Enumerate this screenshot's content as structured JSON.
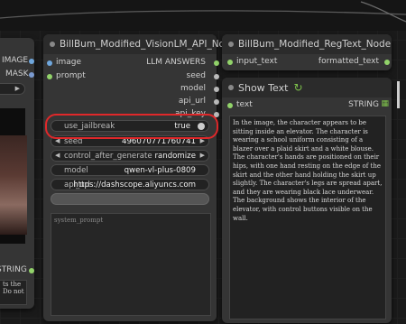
{
  "colors": {
    "accent": "#7ec24b",
    "highlight": "#e0282a",
    "string_port": "#92d36a",
    "image_port": "#6fa7dd",
    "mask_port": "#7a9ad0"
  },
  "left_node": {
    "outputs": [
      {
        "label": "IMAGE"
      },
      {
        "label": "MASK"
      }
    ],
    "string_label": "STRING",
    "snippet_lines": [
      "ts the",
      "Do not"
    ]
  },
  "vision_node": {
    "title": "BillBum_Modified_VisionLM_API_Node",
    "inputs": [
      {
        "label": "image"
      },
      {
        "label": "prompt"
      }
    ],
    "outputs": [
      {
        "label": "LLM ANSWERS"
      },
      {
        "label": "seed"
      },
      {
        "label": "model"
      },
      {
        "label": "api_url"
      },
      {
        "label": "api_key"
      }
    ],
    "widgets": {
      "use_jailbreak": {
        "label": "use_jailbreak",
        "value": "true"
      },
      "seed": {
        "label": "seed",
        "value": "496070771760741"
      },
      "control_after_generate": {
        "label": "control_after_generate",
        "value": "randomize"
      },
      "model": {
        "label": "model",
        "value": "qwen-vl-plus-0809"
      },
      "api_url": {
        "label": "api_url",
        "value": "https://dashscope.aliyuncs.com"
      }
    },
    "system_prompt_placeholder": "system_prompt"
  },
  "regtext_node": {
    "title": "BillBum_Modified_RegText_Node",
    "input": "input_text",
    "output": "formatted_text"
  },
  "showtext_node": {
    "title": "Show Text",
    "title_icon": "refresh-icon",
    "input": "text",
    "output": "STRING",
    "output_icon": "grid-icon",
    "content": "In the image, the character appears to be sitting inside an elevator. The character is wearing a school uniform consisting of a blazer over a plaid skirt and a white blouse. The character's hands are positioned on their hips, with one hand resting on the edge of the skirt and the other hand holding the skirt up slightly. The character's legs are spread apart, and they are wearing black lace underwear. The background shows the interior of the elevator, with control buttons visible on the wall."
  }
}
